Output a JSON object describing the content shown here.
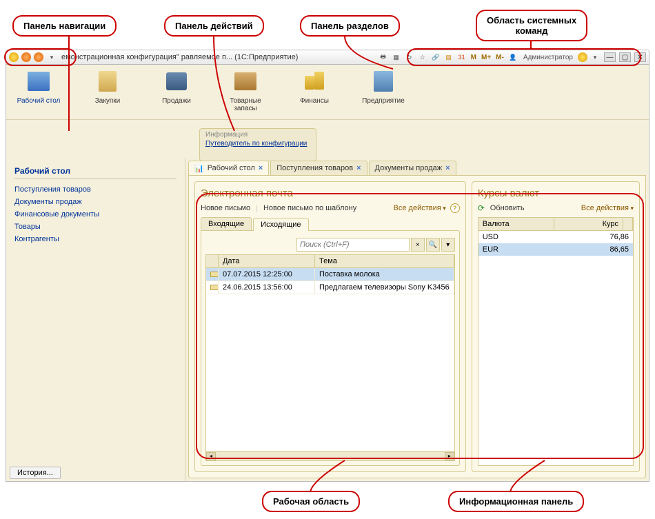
{
  "callouts": {
    "nav": "Панель навигации",
    "actions": "Панель действий",
    "sections": "Панель разделов",
    "syscmd": "Область системных\nкоманд",
    "workarea": "Рабочая область",
    "infopanel": "Информационная панель"
  },
  "titlebar": {
    "text": "емонстрационная конфигурация\"   равляемое п...   (1С:Предприятие)",
    "user": "Администратор",
    "m": "M",
    "mplus": "M+",
    "mminus": "M-"
  },
  "sections": [
    {
      "label": "Рабочий стол",
      "icon": "ico-desk"
    },
    {
      "label": "Закупки",
      "icon": "ico-bag"
    },
    {
      "label": "Продажи",
      "icon": "ico-cash"
    },
    {
      "label": "Товарные запасы",
      "icon": "ico-box"
    },
    {
      "label": "Финансы",
      "icon": "ico-coins"
    },
    {
      "label": "Предприятие",
      "icon": "ico-building"
    }
  ],
  "info": {
    "title": "Информация",
    "link": "Путеводитель по конфигурации"
  },
  "nav": {
    "title": "Рабочий стол",
    "links": [
      "Поступления товаров",
      "Документы продаж",
      "Финансовые документы",
      "Товары",
      "Контрагенты"
    ]
  },
  "tabs": [
    {
      "label": "Рабочий стол",
      "active": true
    },
    {
      "label": "Поступления товаров",
      "active": false
    },
    {
      "label": "Документы продаж",
      "active": false
    }
  ],
  "email": {
    "title": "Электронная почта",
    "new": "Новое письмо",
    "newTemplate": "Новое письмо по шаблону",
    "allActions": "Все действия",
    "subtabs": {
      "inbox": "Входящие",
      "outbox": "Исходящие"
    },
    "searchPlaceholder": "Поиск (Ctrl+F)",
    "cols": {
      "date": "Дата",
      "subj": "Тема"
    },
    "rows": [
      {
        "date": "07.07.2015 12:25:00",
        "subj": "Поставка молока",
        "sel": true
      },
      {
        "date": "24.06.2015 13:56:00",
        "subj": "Предлагаем телевизоры Sony K3456",
        "sel": false
      }
    ]
  },
  "currency": {
    "title": "Курсы валют",
    "refresh": "Обновить",
    "allActions": "Все действия",
    "cols": {
      "cur": "Валюта",
      "rate": "Курс"
    },
    "rows": [
      {
        "cur": "USD",
        "rate": "76,86",
        "sel": false
      },
      {
        "cur": "EUR",
        "rate": "86,65",
        "sel": true
      }
    ]
  },
  "history": "История..."
}
